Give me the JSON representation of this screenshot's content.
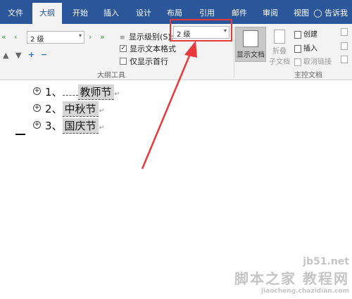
{
  "tabs": [
    "文件",
    "大纲",
    "开始",
    "插入",
    "设计",
    "布局",
    "引用",
    "邮件",
    "审阅",
    "视图"
  ],
  "active_tab": "大纲",
  "tell_me": "告诉我",
  "outline_tools": {
    "level_combo_value": "2 级",
    "show_level_label": "显示级别(S):",
    "show_level_value": "2 级",
    "show_text_format_label": "显示文本格式",
    "show_text_format_checked": "✓",
    "show_first_line_label": "仅显示首行",
    "group_label": "大纲工具"
  },
  "master_doc": {
    "show_document_label": "显示文档",
    "collapse_subdocs_label_1": "折叠",
    "collapse_subdocs_label_2": "子文档",
    "create_label": "创建",
    "insert_label": "插入",
    "unlink_label": "取消链接",
    "group_label": "主控文档"
  },
  "document": {
    "items": [
      {
        "number": "1、",
        "text": "教师节"
      },
      {
        "number": "2、",
        "text": "中秋节"
      },
      {
        "number": "3、",
        "text": "国庆节"
      }
    ]
  },
  "watermark": {
    "line1": "jb51.net",
    "line2": "脚本之家  教程网",
    "line3": "jiaocheng.chazidian.com"
  },
  "colors": {
    "ribbon_blue": "#2b579a",
    "highlight_red": "#e8393a"
  }
}
